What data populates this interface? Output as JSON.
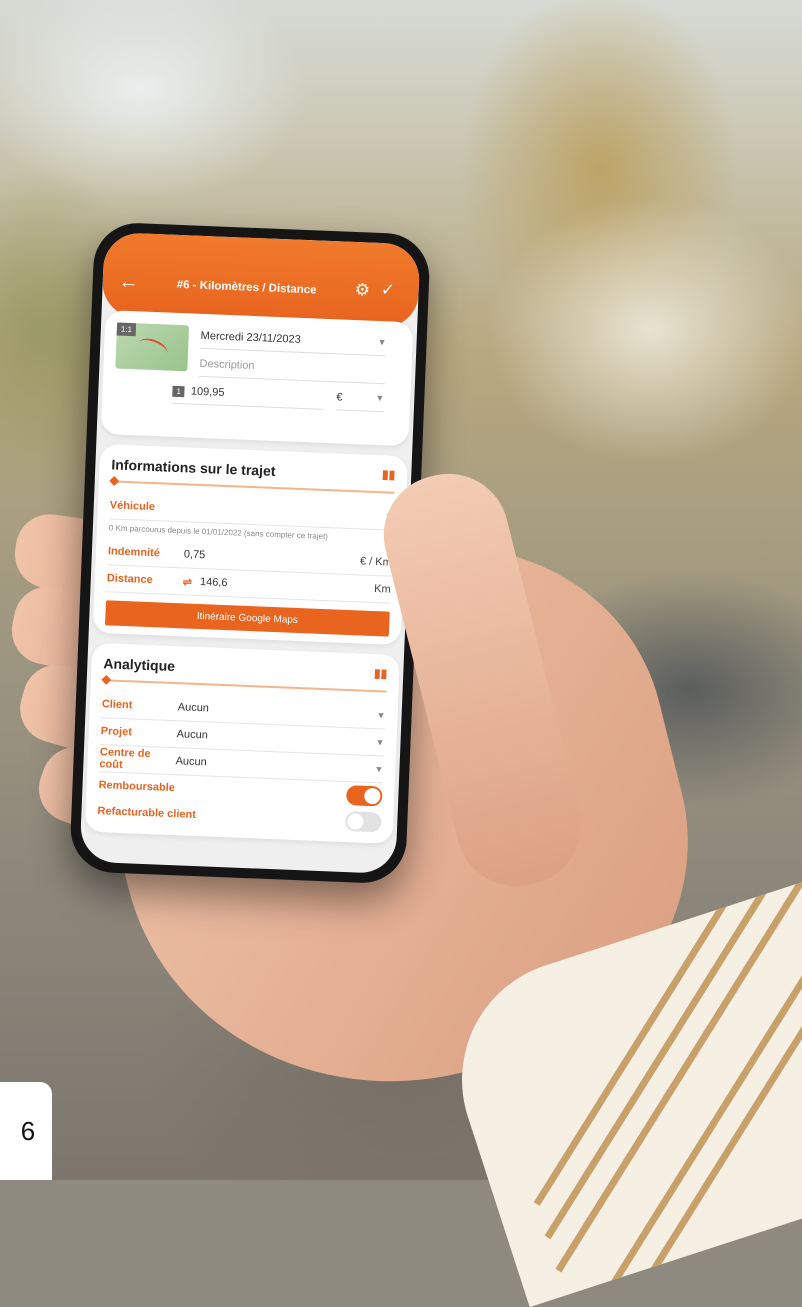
{
  "app": {
    "title": "#6 - Kilomètres / Distance",
    "icons": {
      "back": "back-arrow-icon",
      "settings": "gear-icon",
      "confirm": "check-icon"
    }
  },
  "expense": {
    "thumbnail_badge": "1:1",
    "date": "Mercredi 23/11/2023",
    "description_placeholder": "Description",
    "amount_badge": "1",
    "amount": "109,95",
    "currency": "€"
  },
  "trip": {
    "section_title": "Informations sur le trajet",
    "vehicle_label": "Véhicule",
    "note": "0 Km parcourus depuis le 01/01/2022 (sans compter ce trajet)",
    "allowance_label": "Indemnité",
    "allowance_value": "0,75",
    "allowance_unit": "€ / Km",
    "distance_label": "Distance",
    "distance_value": "146,6",
    "distance_unit": "Km",
    "maps_button": "Itinéraire Google Maps"
  },
  "analytics": {
    "section_title": "Analytique",
    "client_label": "Client",
    "client_value": "Aucun",
    "project_label": "Projet",
    "project_value": "Aucun",
    "cost_center_label": "Centre de coût",
    "cost_center_value": "Aucun",
    "refundable_label": "Remboursable",
    "refundable": true,
    "rebillable_label": "Refacturable client",
    "rebillable": false
  },
  "page_number": "6",
  "colors": {
    "accent": "#e8641f"
  }
}
